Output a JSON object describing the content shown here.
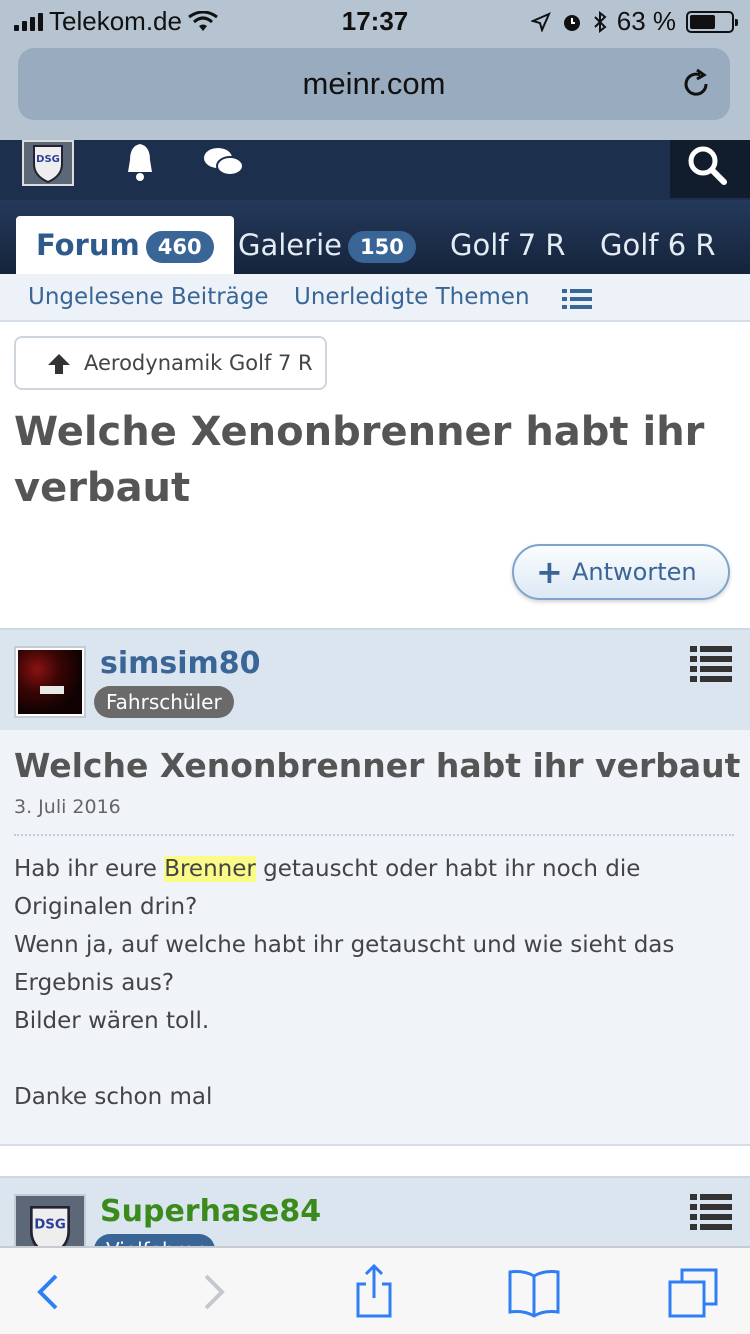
{
  "status": {
    "carrier": "Telekom.de",
    "time": "17:37",
    "battery": "63 %",
    "battery_level": 0.63
  },
  "browser": {
    "url": "meinr.com"
  },
  "tabs": [
    {
      "label": "Forum",
      "badge": "460"
    },
    {
      "label": "Galerie",
      "badge": "150"
    },
    {
      "label": "Golf 7 R"
    },
    {
      "label": "Golf 6 R"
    }
  ],
  "subnav": {
    "unread": "Ungelesene Beiträge",
    "unresolved": "Unerledigte Themen"
  },
  "breadcrumb": "Aerodynamik Golf 7 R",
  "thread": {
    "title": "Welche Xenonbrenner habt ihr verbaut",
    "reply_label": "Antworten"
  },
  "post1": {
    "author": "simsim80",
    "rank": "Fahrschüler",
    "title": "Welche Xenonbrenner habt ihr verbaut",
    "date": "3. Juli 2016",
    "text_a": "Hab ihr eure ",
    "highlight": "Brenner",
    "text_b": " getauscht oder habt ihr noch die Originalen drin?",
    "line2": "Wenn ja, auf welche habt ihr getauscht und wie sieht das Ergebnis aus?",
    "line3": "Bilder wären toll.",
    "line4": "Danke schon mal"
  },
  "post2": {
    "author": "Superhase84",
    "rank": "Vielfahrer"
  },
  "logo": {
    "text": "DSG"
  },
  "colors": {
    "header": "#1c2f4c",
    "accent": "#3a6597",
    "rank_green": "#3a8a1c"
  }
}
